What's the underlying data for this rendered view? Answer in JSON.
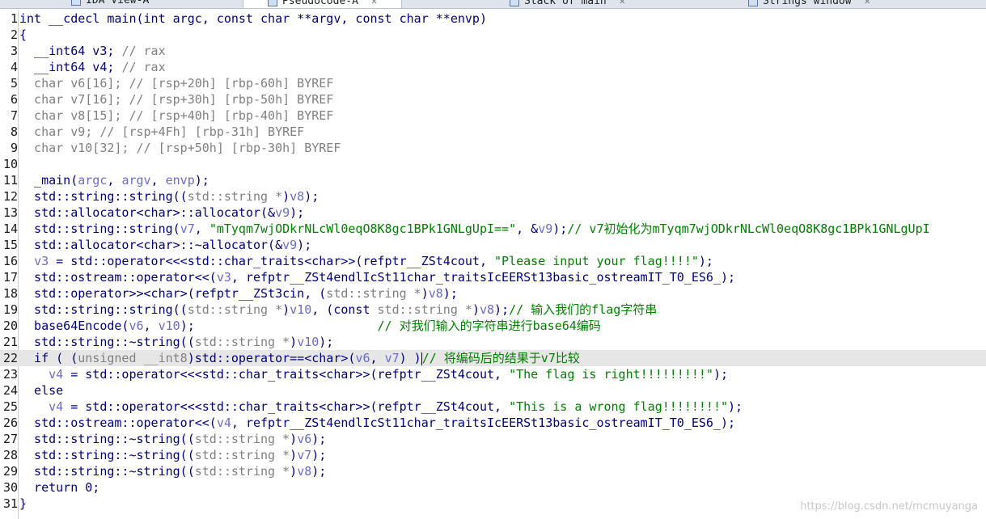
{
  "tabs": [
    {
      "label": "IDA View-A"
    },
    {
      "label": "Pseudocode-A"
    },
    {
      "label": "Stack of main"
    },
    {
      "label": "Strings window"
    }
  ],
  "code": {
    "lines": [
      {
        "n": "1",
        "parts": [
          [
            "",
            "int __cdecl main(int argc, const char **argv, const char **envp)"
          ]
        ]
      },
      {
        "n": "2",
        "parts": [
          [
            "",
            "{"
          ]
        ]
      },
      {
        "n": "3",
        "parts": [
          [
            "",
            "  __int64 v3; "
          ],
          [
            "gray",
            "// rax"
          ]
        ]
      },
      {
        "n": "4",
        "parts": [
          [
            "",
            "  __int64 v4; "
          ],
          [
            "gray",
            "// rax"
          ]
        ]
      },
      {
        "n": "5",
        "parts": [
          [
            "gray",
            "  char v6[16]; // [rsp+20h] [rbp-60h] BYREF"
          ]
        ]
      },
      {
        "n": "6",
        "parts": [
          [
            "gray",
            "  char v7[16]; // [rsp+30h] [rbp-50h] BYREF"
          ]
        ]
      },
      {
        "n": "7",
        "parts": [
          [
            "gray",
            "  char v8[15]; // [rsp+40h] [rbp-40h] BYREF"
          ]
        ]
      },
      {
        "n": "8",
        "parts": [
          [
            "gray",
            "  char v9; // [rsp+4Fh] [rbp-31h] BYREF"
          ]
        ]
      },
      {
        "n": "9",
        "parts": [
          [
            "gray",
            "  char v10[32]; // [rsp+50h] [rbp-30h] BYREF"
          ]
        ]
      },
      {
        "n": "10",
        "parts": [
          [
            "",
            ""
          ]
        ]
      },
      {
        "n": "11",
        "parts": [
          [
            "",
            "  _main("
          ],
          [
            "var",
            "argc"
          ],
          [
            "",
            ", "
          ],
          [
            "var",
            "argv"
          ],
          [
            "",
            ", "
          ],
          [
            "var",
            "envp"
          ],
          [
            "",
            ");"
          ]
        ]
      },
      {
        "n": "12",
        "parts": [
          [
            "",
            "  std::string::string(("
          ],
          [
            "gray",
            "std::string *"
          ],
          [
            "",
            ")"
          ],
          [
            "var",
            "v8"
          ],
          [
            "",
            ");"
          ]
        ]
      },
      {
        "n": "13",
        "parts": [
          [
            "",
            "  std::allocator<char>::allocator(&"
          ],
          [
            "var",
            "v9"
          ],
          [
            "",
            ");"
          ]
        ]
      },
      {
        "n": "14",
        "parts": [
          [
            "",
            "  std::string::string("
          ],
          [
            "var",
            "v7"
          ],
          [
            "",
            ", "
          ],
          [
            "str",
            "\"mTyqm7wjODkrNLcWl0eqO8K8gc1BPk1GNLgUpI==\""
          ],
          [
            "",
            ", &"
          ],
          [
            "var",
            "v9"
          ],
          [
            "",
            ");"
          ],
          [
            "cmt",
            "// v7初始化为mTyqm7wjODkrNLcWl0eqO8K8gc1BPk1GNLgUpI"
          ]
        ]
      },
      {
        "n": "15",
        "parts": [
          [
            "",
            "  std::allocator<char>::~allocator(&"
          ],
          [
            "var",
            "v9"
          ],
          [
            "",
            ");"
          ]
        ]
      },
      {
        "n": "16",
        "parts": [
          [
            "",
            "  "
          ],
          [
            "var",
            "v3"
          ],
          [
            "",
            " = std::operator<<<std::char_traits<char>>(refptr__ZSt4cout, "
          ],
          [
            "str",
            "\"Please input your flag!!!!\""
          ],
          [
            "",
            ");"
          ]
        ]
      },
      {
        "n": "17",
        "parts": [
          [
            "",
            "  std::ostream::operator<<("
          ],
          [
            "var",
            "v3"
          ],
          [
            "",
            ", refptr__ZSt4endlIcSt11char_traitsIcEERSt13basic_ostreamIT_T0_ES6_);"
          ]
        ]
      },
      {
        "n": "18",
        "parts": [
          [
            "",
            "  std::operator>><char>(refptr__ZSt3cin, ("
          ],
          [
            "gray",
            "std::string *"
          ],
          [
            "",
            ")"
          ],
          [
            "var",
            "v8"
          ],
          [
            "",
            ");"
          ]
        ]
      },
      {
        "n": "19",
        "parts": [
          [
            "",
            "  std::string::string(("
          ],
          [
            "gray",
            "std::string *"
          ],
          [
            "",
            ")"
          ],
          [
            "var",
            "v10"
          ],
          [
            "",
            ", (const "
          ],
          [
            "gray",
            "std::string *"
          ],
          [
            "",
            ")"
          ],
          [
            "var",
            "v8"
          ],
          [
            "",
            ");"
          ],
          [
            "cmt",
            "// 输入我们的flag字符串"
          ]
        ]
      },
      {
        "n": "20",
        "parts": [
          [
            "",
            "  base64Encode("
          ],
          [
            "var",
            "v6"
          ],
          [
            "",
            ", "
          ],
          [
            "var",
            "v10"
          ],
          [
            "",
            ");                         "
          ],
          [
            "cmt",
            "// 对我们输入的字符串进行base64编码"
          ]
        ]
      },
      {
        "n": "21",
        "parts": [
          [
            "",
            "  std::string::~string(("
          ],
          [
            "gray",
            "std::string *"
          ],
          [
            "",
            ")"
          ],
          [
            "var",
            "v10"
          ],
          [
            "",
            ");"
          ]
        ]
      },
      {
        "n": "22",
        "hl": true,
        "parts": [
          [
            "",
            "  if ( ("
          ],
          [
            "gray",
            "unsigned __int8"
          ],
          [
            "",
            ")std::operator==<char>("
          ],
          [
            "var",
            "v6"
          ],
          [
            "",
            ", "
          ],
          [
            "var",
            "v7"
          ],
          [
            "",
            ") )"
          ],
          [
            "cursor",
            ""
          ],
          [
            "cmt",
            "// 将编码后的结果于v7比较"
          ]
        ]
      },
      {
        "n": "23",
        "parts": [
          [
            "",
            "    "
          ],
          [
            "var",
            "v4"
          ],
          [
            "",
            " = std::operator<<<std::char_traits<char>>(refptr__ZSt4cout, "
          ],
          [
            "str",
            "\"The flag is right!!!!!!!!!\""
          ],
          [
            "",
            ");"
          ]
        ]
      },
      {
        "n": "24",
        "parts": [
          [
            "",
            "  else"
          ]
        ]
      },
      {
        "n": "25",
        "parts": [
          [
            "",
            "    "
          ],
          [
            "var",
            "v4"
          ],
          [
            "",
            " = std::operator<<<std::char_traits<char>>(refptr__ZSt4cout, "
          ],
          [
            "str",
            "\"This is a wrong flag!!!!!!!!\""
          ],
          [
            "",
            ");"
          ]
        ]
      },
      {
        "n": "26",
        "parts": [
          [
            "",
            "  std::ostream::operator<<("
          ],
          [
            "var",
            "v4"
          ],
          [
            "",
            ", refptr__ZSt4endlIcSt11char_traitsIcEERSt13basic_ostreamIT_T0_ES6_);"
          ]
        ]
      },
      {
        "n": "27",
        "parts": [
          [
            "",
            "  std::string::~string(("
          ],
          [
            "gray",
            "std::string *"
          ],
          [
            "",
            ")"
          ],
          [
            "var",
            "v6"
          ],
          [
            "",
            ");"
          ]
        ]
      },
      {
        "n": "28",
        "parts": [
          [
            "",
            "  std::string::~string(("
          ],
          [
            "gray",
            "std::string *"
          ],
          [
            "",
            ")"
          ],
          [
            "var",
            "v7"
          ],
          [
            "",
            ");"
          ]
        ]
      },
      {
        "n": "29",
        "parts": [
          [
            "",
            "  std::string::~string(("
          ],
          [
            "gray",
            "std::string *"
          ],
          [
            "",
            ")"
          ],
          [
            "var",
            "v8"
          ],
          [
            "",
            ");"
          ]
        ]
      },
      {
        "n": "30",
        "parts": [
          [
            "",
            "  return 0;"
          ]
        ]
      },
      {
        "n": "31",
        "parts": [
          [
            "",
            "}"
          ]
        ]
      }
    ]
  },
  "watermark": "https://blog.csdn.net/mcmuyanga",
  "colors": {
    "keyword_text": "#000080",
    "variable": "#6a6ad0",
    "string": "#008000",
    "comment": "#008000",
    "muted": "#808080",
    "highlight_line": "#e6e6e6"
  }
}
